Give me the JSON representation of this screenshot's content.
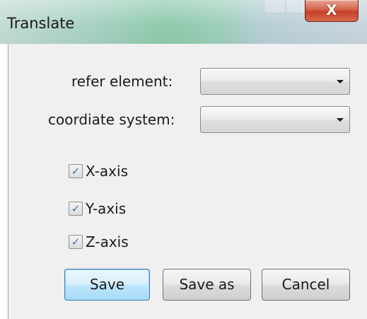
{
  "window": {
    "title": "Translate",
    "close_glyph": "X"
  },
  "form": {
    "refer_element_label": "refer element:",
    "refer_element_value": "",
    "coordinate_system_label": "coordiate system:",
    "coordinate_system_value": ""
  },
  "axes": [
    {
      "label": "X-axis",
      "checked": true
    },
    {
      "label": "Y-axis",
      "checked": true
    },
    {
      "label": "Z-axis",
      "checked": true
    }
  ],
  "buttons": {
    "save_label": "Save",
    "save_as_label": "Save as",
    "cancel_label": "Cancel"
  },
  "icons": {
    "checkmark": "checkmark-icon",
    "dropdown": "chevron-down-icon",
    "close": "close-icon"
  },
  "colors": {
    "default_button_border": "#3c7fb1",
    "close_button": "#c4402a",
    "panel_background": "#f0f0f0"
  }
}
